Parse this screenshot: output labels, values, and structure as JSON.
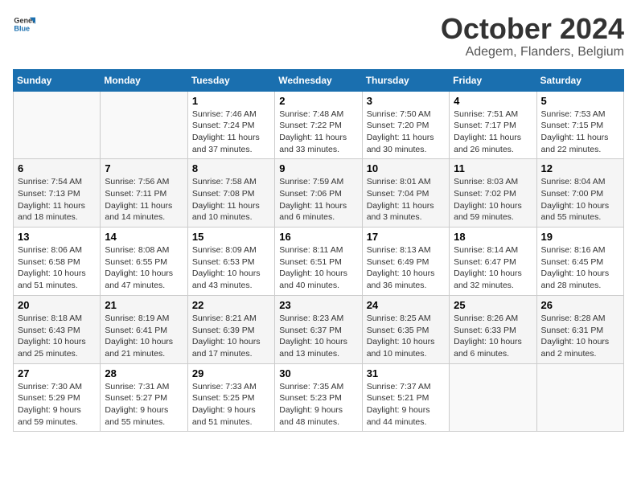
{
  "header": {
    "logo_line1": "General",
    "logo_line2": "Blue",
    "month": "October 2024",
    "location": "Adegem, Flanders, Belgium"
  },
  "days_of_week": [
    "Sunday",
    "Monday",
    "Tuesday",
    "Wednesday",
    "Thursday",
    "Friday",
    "Saturday"
  ],
  "weeks": [
    [
      {
        "num": "",
        "info": ""
      },
      {
        "num": "",
        "info": ""
      },
      {
        "num": "1",
        "info": "Sunrise: 7:46 AM\nSunset: 7:24 PM\nDaylight: 11 hours and 37 minutes."
      },
      {
        "num": "2",
        "info": "Sunrise: 7:48 AM\nSunset: 7:22 PM\nDaylight: 11 hours and 33 minutes."
      },
      {
        "num": "3",
        "info": "Sunrise: 7:50 AM\nSunset: 7:20 PM\nDaylight: 11 hours and 30 minutes."
      },
      {
        "num": "4",
        "info": "Sunrise: 7:51 AM\nSunset: 7:17 PM\nDaylight: 11 hours and 26 minutes."
      },
      {
        "num": "5",
        "info": "Sunrise: 7:53 AM\nSunset: 7:15 PM\nDaylight: 11 hours and 22 minutes."
      }
    ],
    [
      {
        "num": "6",
        "info": "Sunrise: 7:54 AM\nSunset: 7:13 PM\nDaylight: 11 hours and 18 minutes."
      },
      {
        "num": "7",
        "info": "Sunrise: 7:56 AM\nSunset: 7:11 PM\nDaylight: 11 hours and 14 minutes."
      },
      {
        "num": "8",
        "info": "Sunrise: 7:58 AM\nSunset: 7:08 PM\nDaylight: 11 hours and 10 minutes."
      },
      {
        "num": "9",
        "info": "Sunrise: 7:59 AM\nSunset: 7:06 PM\nDaylight: 11 hours and 6 minutes."
      },
      {
        "num": "10",
        "info": "Sunrise: 8:01 AM\nSunset: 7:04 PM\nDaylight: 11 hours and 3 minutes."
      },
      {
        "num": "11",
        "info": "Sunrise: 8:03 AM\nSunset: 7:02 PM\nDaylight: 10 hours and 59 minutes."
      },
      {
        "num": "12",
        "info": "Sunrise: 8:04 AM\nSunset: 7:00 PM\nDaylight: 10 hours and 55 minutes."
      }
    ],
    [
      {
        "num": "13",
        "info": "Sunrise: 8:06 AM\nSunset: 6:58 PM\nDaylight: 10 hours and 51 minutes."
      },
      {
        "num": "14",
        "info": "Sunrise: 8:08 AM\nSunset: 6:55 PM\nDaylight: 10 hours and 47 minutes."
      },
      {
        "num": "15",
        "info": "Sunrise: 8:09 AM\nSunset: 6:53 PM\nDaylight: 10 hours and 43 minutes."
      },
      {
        "num": "16",
        "info": "Sunrise: 8:11 AM\nSunset: 6:51 PM\nDaylight: 10 hours and 40 minutes."
      },
      {
        "num": "17",
        "info": "Sunrise: 8:13 AM\nSunset: 6:49 PM\nDaylight: 10 hours and 36 minutes."
      },
      {
        "num": "18",
        "info": "Sunrise: 8:14 AM\nSunset: 6:47 PM\nDaylight: 10 hours and 32 minutes."
      },
      {
        "num": "19",
        "info": "Sunrise: 8:16 AM\nSunset: 6:45 PM\nDaylight: 10 hours and 28 minutes."
      }
    ],
    [
      {
        "num": "20",
        "info": "Sunrise: 8:18 AM\nSunset: 6:43 PM\nDaylight: 10 hours and 25 minutes."
      },
      {
        "num": "21",
        "info": "Sunrise: 8:19 AM\nSunset: 6:41 PM\nDaylight: 10 hours and 21 minutes."
      },
      {
        "num": "22",
        "info": "Sunrise: 8:21 AM\nSunset: 6:39 PM\nDaylight: 10 hours and 17 minutes."
      },
      {
        "num": "23",
        "info": "Sunrise: 8:23 AM\nSunset: 6:37 PM\nDaylight: 10 hours and 13 minutes."
      },
      {
        "num": "24",
        "info": "Sunrise: 8:25 AM\nSunset: 6:35 PM\nDaylight: 10 hours and 10 minutes."
      },
      {
        "num": "25",
        "info": "Sunrise: 8:26 AM\nSunset: 6:33 PM\nDaylight: 10 hours and 6 minutes."
      },
      {
        "num": "26",
        "info": "Sunrise: 8:28 AM\nSunset: 6:31 PM\nDaylight: 10 hours and 2 minutes."
      }
    ],
    [
      {
        "num": "27",
        "info": "Sunrise: 7:30 AM\nSunset: 5:29 PM\nDaylight: 9 hours and 59 minutes."
      },
      {
        "num": "28",
        "info": "Sunrise: 7:31 AM\nSunset: 5:27 PM\nDaylight: 9 hours and 55 minutes."
      },
      {
        "num": "29",
        "info": "Sunrise: 7:33 AM\nSunset: 5:25 PM\nDaylight: 9 hours and 51 minutes."
      },
      {
        "num": "30",
        "info": "Sunrise: 7:35 AM\nSunset: 5:23 PM\nDaylight: 9 hours and 48 minutes."
      },
      {
        "num": "31",
        "info": "Sunrise: 7:37 AM\nSunset: 5:21 PM\nDaylight: 9 hours and 44 minutes."
      },
      {
        "num": "",
        "info": ""
      },
      {
        "num": "",
        "info": ""
      }
    ]
  ]
}
